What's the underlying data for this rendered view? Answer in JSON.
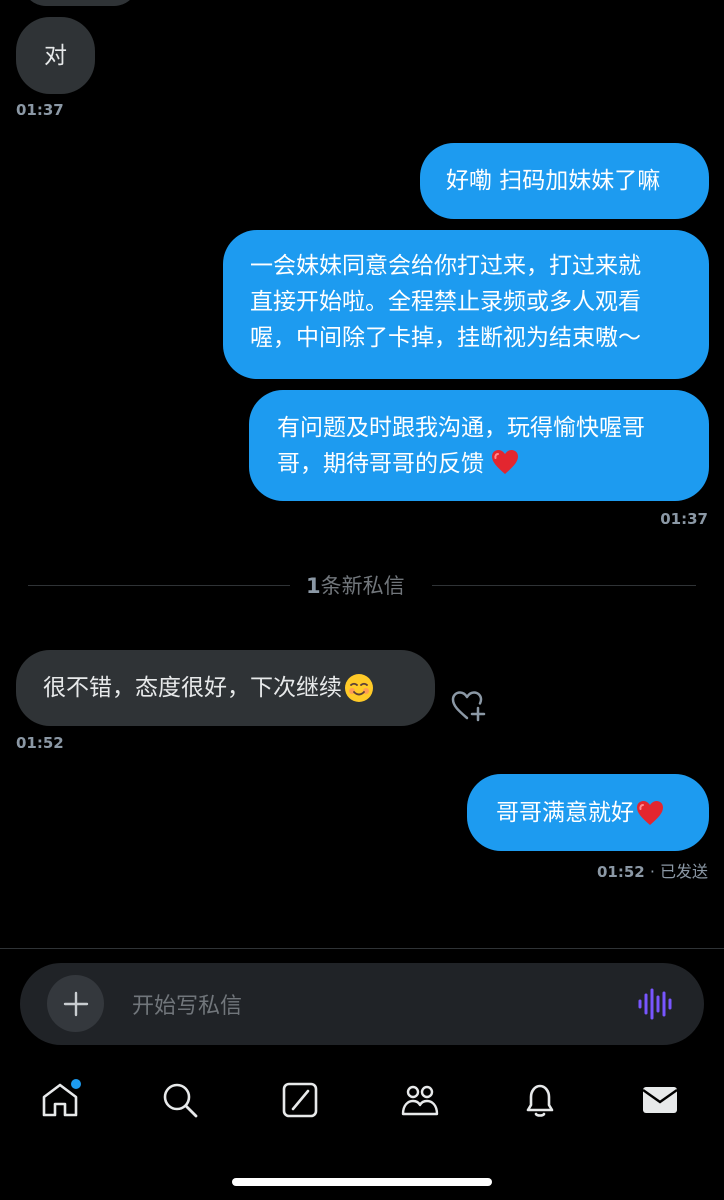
{
  "conversation": {
    "messages": [
      {
        "direction": "incoming",
        "text": "对"
      },
      {
        "direction": "outgoing",
        "text": "好嘞 扫码加妹妹了嘛"
      },
      {
        "direction": "outgoing",
        "lines": [
          "一会妹妹同意会给你打过来，打过来就",
          "直接开始啦。全程禁止录频或多人观看",
          "喔，中间除了卡掉，挂断视为结束嗷～"
        ]
      },
      {
        "direction": "outgoing",
        "lines": [
          "有问题及时跟我沟通，玩得愉快喔哥",
          "哥，期待哥哥的反馈"
        ],
        "emoji": "red-heart"
      },
      {
        "direction": "incoming",
        "text": "很不错，态度很好，下次继续",
        "emoji": "smiling-face"
      },
      {
        "direction": "outgoing",
        "text": "哥哥满意就好",
        "emoji": "red-heart"
      }
    ],
    "timestamps": {
      "first_in": "01:37",
      "first_out": "01:37",
      "second_in": "01:52",
      "second_out": "01:52",
      "sent_status": "· 已发送"
    },
    "new_messages_count": "1",
    "new_messages_label": "条新私信"
  },
  "composer": {
    "placeholder": "开始写私信"
  },
  "bottom_nav": {
    "items": [
      {
        "name": "home",
        "icon": "home-icon",
        "badge": true
      },
      {
        "name": "search",
        "icon": "search-icon"
      },
      {
        "name": "grok",
        "icon": "grok-icon"
      },
      {
        "name": "communities",
        "icon": "people-icon"
      },
      {
        "name": "notifications",
        "icon": "bell-icon"
      },
      {
        "name": "messages",
        "icon": "mail-icon",
        "active": true
      }
    ]
  },
  "colors": {
    "accent": "#1d9bf0",
    "incoming_bubble": "#2f3336",
    "voice": "#7856ff"
  }
}
